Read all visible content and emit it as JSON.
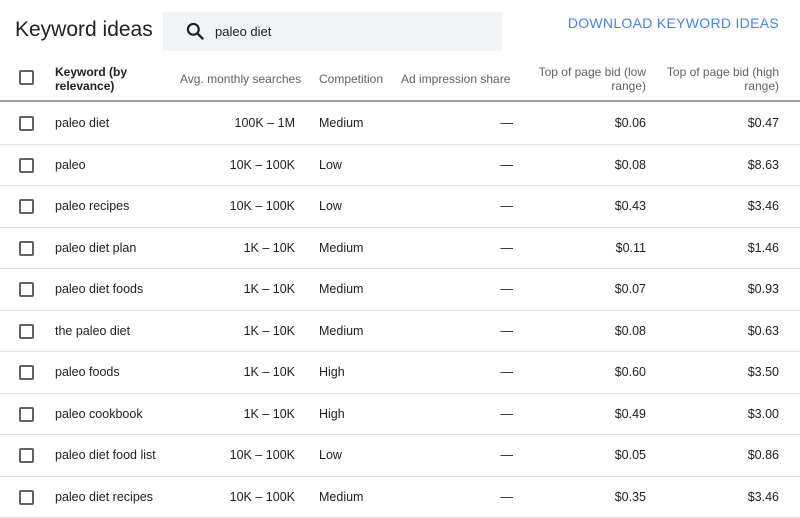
{
  "title": "Keyword ideas",
  "search": {
    "value": "paleo diet",
    "icon": "search-icon"
  },
  "download_label": "DOWNLOAD KEYWORD IDEAS",
  "columns": {
    "keyword": "Keyword (by relevance)",
    "keyword_line1": "Keyword (by",
    "keyword_line2": "relevance)",
    "searches": "Avg. monthly searches",
    "competition": "Competition",
    "impression": "Ad impression share",
    "bid_low_line1": "Top of page bid (low",
    "bid_low_line2": "range)",
    "bid_high_line1": "Top of page bid (high",
    "bid_high_line2": "range)"
  },
  "rows": [
    {
      "keyword": "paleo diet",
      "searches": "100K – 1M",
      "competition": "Medium",
      "impression": "—",
      "bid_low": "$0.06",
      "bid_high": "$0.47"
    },
    {
      "keyword": "paleo",
      "searches": "10K – 100K",
      "competition": "Low",
      "impression": "—",
      "bid_low": "$0.08",
      "bid_high": "$8.63"
    },
    {
      "keyword": "paleo recipes",
      "searches": "10K – 100K",
      "competition": "Low",
      "impression": "—",
      "bid_low": "$0.43",
      "bid_high": "$3.46"
    },
    {
      "keyword": "paleo diet plan",
      "searches": "1K – 10K",
      "competition": "Medium",
      "impression": "—",
      "bid_low": "$0.11",
      "bid_high": "$1.46"
    },
    {
      "keyword": "paleo diet foods",
      "searches": "1K – 10K",
      "competition": "Medium",
      "impression": "—",
      "bid_low": "$0.07",
      "bid_high": "$0.93"
    },
    {
      "keyword": "the paleo diet",
      "searches": "1K – 10K",
      "competition": "Medium",
      "impression": "—",
      "bid_low": "$0.08",
      "bid_high": "$0.63"
    },
    {
      "keyword": "paleo foods",
      "searches": "1K – 10K",
      "competition": "High",
      "impression": "—",
      "bid_low": "$0.60",
      "bid_high": "$3.50"
    },
    {
      "keyword": "paleo cookbook",
      "searches": "1K – 10K",
      "competition": "High",
      "impression": "—",
      "bid_low": "$0.49",
      "bid_high": "$3.00"
    },
    {
      "keyword": "paleo diet food list",
      "searches": "10K – 100K",
      "competition": "Low",
      "impression": "—",
      "bid_low": "$0.05",
      "bid_high": "$0.86"
    },
    {
      "keyword": "paleo diet recipes",
      "searches": "10K – 100K",
      "competition": "Medium",
      "impression": "—",
      "bid_low": "$0.35",
      "bid_high": "$3.46"
    }
  ],
  "colors": {
    "accent": "#4285f4",
    "text": "#202124",
    "muted": "#5f6368",
    "search_bg": "#f1f3f4",
    "divider": "#e0e0e0"
  }
}
